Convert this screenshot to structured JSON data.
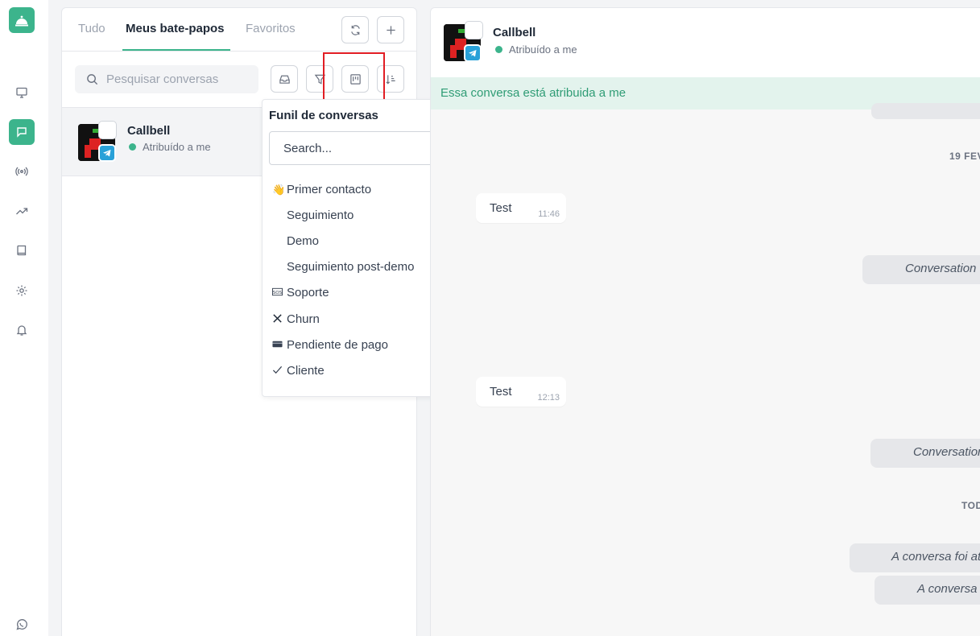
{
  "sidebar": {
    "icons": [
      "bell-service-logo-icon",
      "monitor-icon",
      "chat-icon",
      "broadcast-icon",
      "trending-icon",
      "book-icon",
      "settings-icon",
      "notification-bell-icon",
      "whatsapp-icon"
    ]
  },
  "list": {
    "tabs": [
      {
        "label": "Tudo"
      },
      {
        "label": "Meus bate-papos"
      },
      {
        "label": "Favoritos"
      }
    ],
    "search_placeholder": "Pesquisar conversas",
    "conversation": {
      "name": "Callbell",
      "status": "Atribuído a me"
    }
  },
  "funnel_dropdown": {
    "title": "Funil de conversas",
    "search_placeholder": "Search...",
    "items": [
      {
        "icon": "wave-icon",
        "label": "Primer contacto"
      },
      {
        "icon": "",
        "label": "Seguimiento"
      },
      {
        "icon": "",
        "label": "Demo"
      },
      {
        "icon": "",
        "label": "Seguimiento post-demo"
      },
      {
        "icon": "sos-icon",
        "label": "Soporte"
      },
      {
        "icon": "x-icon",
        "label": "Churn"
      },
      {
        "icon": "credit-card-icon",
        "label": "Pendiente de pago"
      },
      {
        "icon": "check-icon",
        "label": "Cliente"
      }
    ]
  },
  "chat": {
    "contact_name": "Callbell",
    "contact_status": "Atribuído a me",
    "assign_banner": "Essa conversa está atribuida a me",
    "dates": [
      "19 FEV",
      "TOD"
    ],
    "messages": [
      {
        "text": "Test",
        "time": "11:46"
      },
      {
        "text": "Test",
        "time": "12:13"
      }
    ],
    "system_messages": [
      "Conversation v",
      "Conversation",
      "A conversa foi at",
      "A conversa"
    ]
  },
  "colors": {
    "accent": "#3cb48c",
    "highlight_border": "#e11d24",
    "telegram": "#29a1d8"
  }
}
